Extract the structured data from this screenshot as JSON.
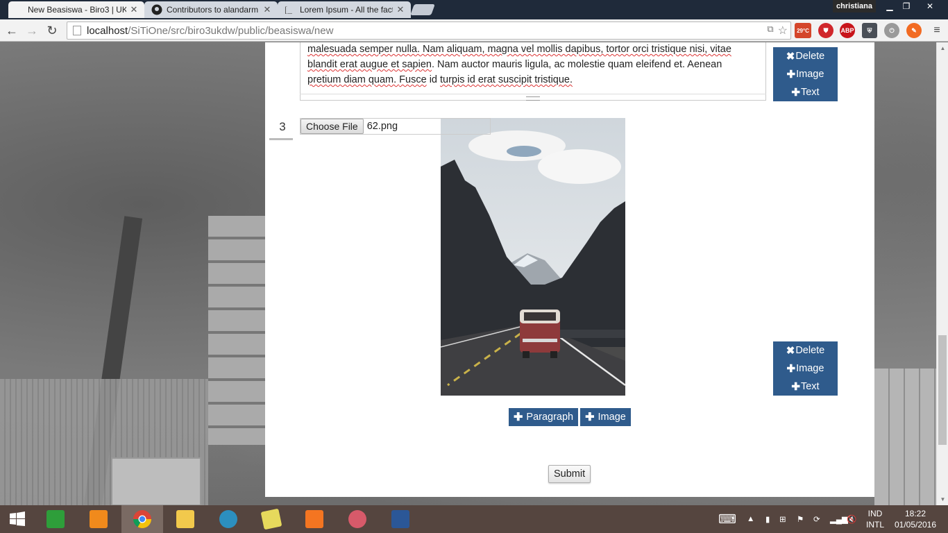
{
  "browser": {
    "tabs": [
      {
        "title": "New Beasiswa - Biro3 | UK",
        "active": true
      },
      {
        "title": "Contributors to alandarm",
        "active": false
      },
      {
        "title": "Lorem Ipsum - All the fact",
        "active": false
      }
    ],
    "profile_name": "christiana",
    "url_host": "localhost",
    "url_path": "/SiTiOne/src/biro3ukdw/public/beasiswa/new",
    "weather_badge": "29°C",
    "adblock_badge": "ABP"
  },
  "editor": {
    "paragraph_text": {
      "line1": "malesuada semper nulla. Nam aliquam, magna vel mollis dapibus, tortor orci tristique nisi, vitae",
      "line2_pre": "blandit erat augue et sapien",
      "line2_post": ". Nam auctor mauris ligula, ac molestie quam eleifend et. Aenean",
      "line3_pre": "pretium diam quam. ",
      "line3_fusce": "Fusce",
      "line3_mid": " id ",
      "line3_turpis": "turpis",
      "line3_end": " id erat suscipit tristique."
    },
    "block1_actions": {
      "delete": "Delete",
      "image": "Image",
      "text": "Text"
    },
    "block2": {
      "number": "3",
      "choose_file_label": "Choose File",
      "file_name": "62.png"
    },
    "block2_actions": {
      "delete": "Delete",
      "image": "Image",
      "text": "Text"
    },
    "add_paragraph_label": "Paragraph",
    "add_image_label": "Image",
    "submit_label": "Submit"
  },
  "taskbar": {
    "language_top": "IND",
    "language_bottom": "INTL",
    "time": "18:22",
    "date": "01/05/2016"
  },
  "colors": {
    "action_blue": "#2f5b8c",
    "taskbar": "#55453f",
    "tab_strip": "#1f2a3a"
  }
}
